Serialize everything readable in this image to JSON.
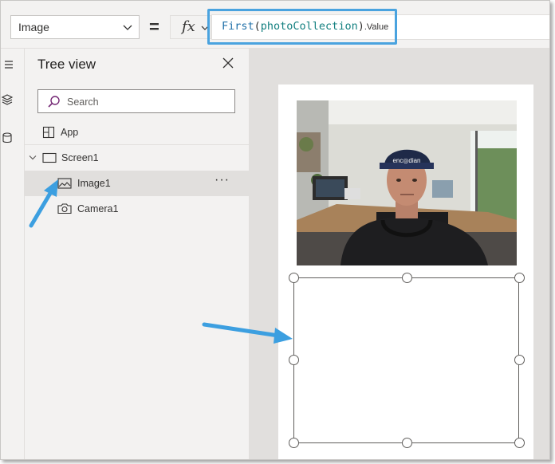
{
  "formula_bar": {
    "property": "Image",
    "fx_label": "fx",
    "formula_fn": "First",
    "formula_open": "(",
    "formula_arg": "photoCollection",
    "formula_close": ")",
    "formula_prop": ".Value"
  },
  "tree_view": {
    "title": "Tree view",
    "search_placeholder": "Search",
    "items": [
      {
        "label": "App",
        "icon": "app-icon"
      },
      {
        "label": "Screen1",
        "icon": "screen-icon"
      },
      {
        "label": "Image1",
        "icon": "image-icon",
        "more": "···"
      },
      {
        "label": "Camera1",
        "icon": "camera-icon"
      }
    ]
  },
  "colors": {
    "highlight": "#4aa3df",
    "formula_fn": "#1e6fa8",
    "formula_arg": "#127f7f",
    "search_icon": "#742774"
  }
}
